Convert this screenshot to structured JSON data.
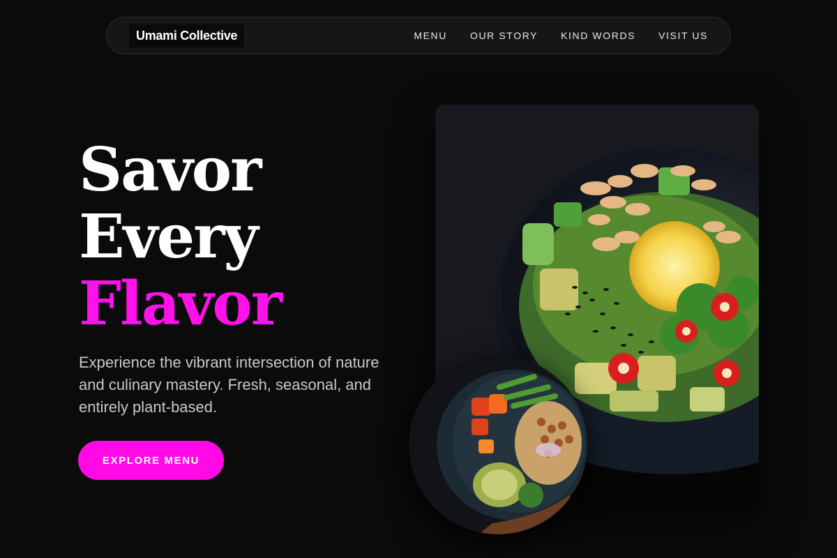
{
  "brand": {
    "name": "Umami Collective"
  },
  "nav": {
    "items": [
      {
        "label": "MENU"
      },
      {
        "label": "OUR STORY"
      },
      {
        "label": "KIND WORDS"
      },
      {
        "label": "VISIT US"
      }
    ]
  },
  "hero": {
    "title_line1": "Savor",
    "title_line2": "Every",
    "title_accent": "Flavor",
    "subtitle": "Experience the vibrant intersection of nature and culinary mastery. Fresh, seasonal, and entirely plant-based.",
    "cta_label": "EXPLORE MENU"
  },
  "colors": {
    "background": "#0b0b0c",
    "accent": "#ff11ea",
    "button": "#ff0ae6",
    "nav_bg": "#161617",
    "text_muted": "#c9c9cc"
  },
  "images": {
    "main": "salad-bowl-photo",
    "round": "grain-bowl-photo"
  }
}
